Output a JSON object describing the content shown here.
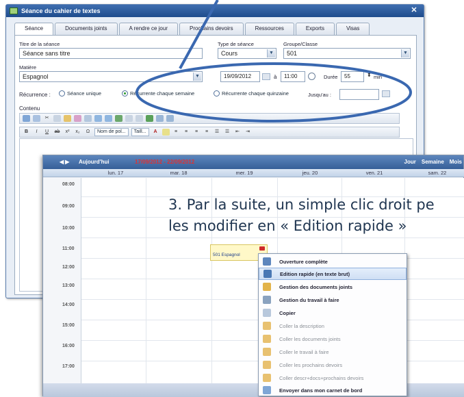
{
  "window_form": {
    "title": "Séance du cahier de textes",
    "tabs": [
      "Séance",
      "Documents joints",
      "A rendre ce jour",
      "Prochains devoirs",
      "Ressources",
      "Exports",
      "Visas"
    ],
    "titre_label": "Titre de la séance",
    "titre_value": "Séance sans titre",
    "type_label": "Type de séance",
    "type_value": "Cours",
    "groupe_label": "Groupe/Classe",
    "groupe_value": "501",
    "matiere_label": "Matière",
    "matiere_value": "Espagnol",
    "date_value": "19/09/2012",
    "a_label": "à",
    "time_value": "11:00",
    "duree_label": "Durée",
    "duree_value": "55",
    "duree_unit": "min",
    "recurrence_label": "Récurrence :",
    "recurrence_options": [
      "Séance unique",
      "Récurrente chaque semaine",
      "Récurrente chaque quinzaine"
    ],
    "recurrence_selected": 1,
    "jusqua_label": "Jusqu'au :",
    "contenu_label": "Contenu",
    "font_select": "Nom de pol...",
    "size_select": "Taill..."
  },
  "agenda": {
    "today_label": "Aujourd'hui",
    "range_label": "17/09/2012 - 22/09/2012",
    "views": [
      "Jour",
      "Semaine",
      "Mois"
    ],
    "days": [
      "lun. 17",
      "mar. 18",
      "mer. 19",
      "jeu. 20",
      "ven. 21",
      "sam. 22"
    ],
    "hours": [
      "08:00",
      "09:00",
      "10:00",
      "11:00",
      "12:00",
      "13:00",
      "14:00",
      "15:00",
      "16:00",
      "17:00"
    ],
    "event_label": "501 Espagnol"
  },
  "headline": {
    "line1": "3. Par la suite, un simple clic droit pe",
    "line2": "les modifier en « Edition rapide »"
  },
  "context_menu": {
    "items": [
      {
        "label": "Ouverture complète",
        "state": "normal",
        "icon": "open-icon"
      },
      {
        "label": "Edition rapide (en texte brut)",
        "state": "highlighted",
        "icon": "quick-edit-icon"
      },
      {
        "label": "Gestion des documents joints",
        "state": "normal",
        "icon": "attachment-icon"
      },
      {
        "label": "Gestion du travail à faire",
        "state": "normal",
        "icon": "homework-icon"
      },
      {
        "label": "Copier",
        "state": "normal",
        "icon": "copy-icon"
      },
      {
        "label": "Coller la description",
        "state": "disabled",
        "icon": "paste-icon"
      },
      {
        "label": "Coller les documents joints",
        "state": "disabled",
        "icon": "paste-icon"
      },
      {
        "label": "Coller le travail à faire",
        "state": "disabled",
        "icon": "paste-icon"
      },
      {
        "label": "Coller les prochains devoirs",
        "state": "disabled",
        "icon": "paste-icon"
      },
      {
        "label": "Coller descr+docs+prochains devoirs",
        "state": "disabled",
        "icon": "paste-icon"
      },
      {
        "label": "Envoyer dans mon carnet de bord",
        "state": "normal",
        "icon": "send-icon"
      }
    ]
  },
  "colors": {
    "title_bar": "#2b5a9c",
    "annotation": "#3a68b0",
    "range_text": "#e03030",
    "menu_highlight": "#cfdff4"
  }
}
